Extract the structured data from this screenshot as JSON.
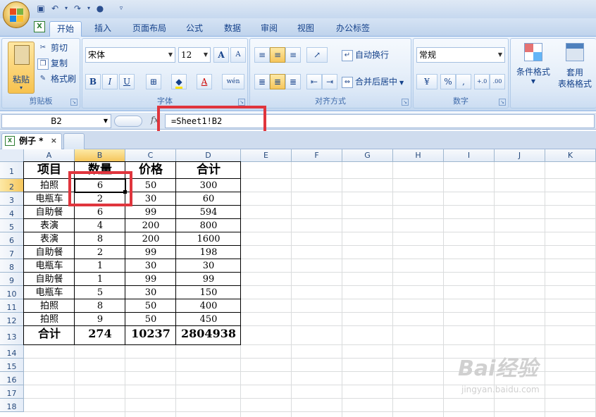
{
  "ribbon_tabs": [
    "开始",
    "插入",
    "页面布局",
    "公式",
    "数据",
    "审阅",
    "视图",
    "办公标签"
  ],
  "clipboard": {
    "paste": "粘贴",
    "cut": "剪切",
    "copy": "复制",
    "format_painter": "格式刷",
    "label": "剪贴板"
  },
  "font": {
    "name": "宋体",
    "size": "12",
    "label": "字体",
    "bold": "B",
    "italic": "I",
    "underline": "U",
    "grow": "A",
    "font_color_glyph": "A",
    "phonetic": "wén"
  },
  "alignment": {
    "wrap": "自动换行",
    "merge": "合并后居中",
    "label": "对齐方式"
  },
  "number": {
    "format": "常规",
    "label": "数字",
    "percent": "%",
    "comma": ",",
    "dec_inc": "+.0",
    "dec_dec": ".00"
  },
  "styles": {
    "conditional": "条件格式",
    "table_format_1": "套用",
    "table_format_2": "表格格式"
  },
  "formula_bar": {
    "name_box": "B2",
    "fx": "fx",
    "formula": "=Sheet1!B2"
  },
  "doc_tab": "例子 *",
  "sheet": {
    "columns": [
      "A",
      "B",
      "C",
      "D",
      "E",
      "F",
      "G",
      "H",
      "I",
      "J",
      "K"
    ],
    "rows": [
      "1",
      "2",
      "3",
      "4",
      "5",
      "6",
      "7",
      "8",
      "9",
      "10",
      "11",
      "12",
      "13",
      "14",
      "15",
      "16",
      "17",
      "18"
    ],
    "header": [
      "项目",
      "数量",
      "价格",
      "合计"
    ],
    "data": [
      [
        "拍照",
        "6",
        "50",
        "300"
      ],
      [
        "电瓶车",
        "2",
        "30",
        "60"
      ],
      [
        "自助餐",
        "6",
        "99",
        "594"
      ],
      [
        "表演",
        "4",
        "200",
        "800"
      ],
      [
        "表演",
        "8",
        "200",
        "1600"
      ],
      [
        "自助餐",
        "2",
        "99",
        "198"
      ],
      [
        "电瓶车",
        "1",
        "30",
        "30"
      ],
      [
        "自助餐",
        "1",
        "99",
        "99"
      ],
      [
        "电瓶车",
        "5",
        "30",
        "150"
      ],
      [
        "拍照",
        "8",
        "50",
        "400"
      ],
      [
        "拍照",
        "9",
        "50",
        "450"
      ]
    ],
    "total": [
      "合计",
      "274",
      "10237",
      "2804938"
    ]
  },
  "watermark": {
    "main": "Bai经验",
    "sub": "jingyan.baidu.com"
  }
}
